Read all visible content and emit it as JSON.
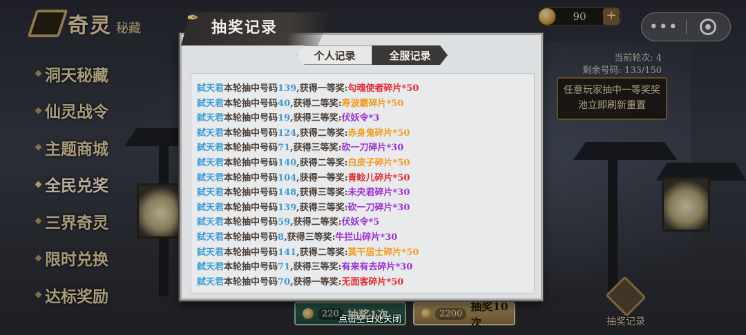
{
  "sidebar": {
    "logo_title": "奇灵",
    "logo_sub": "秘藏",
    "items": [
      {
        "label": "洞天秘藏",
        "active": false
      },
      {
        "label": "仙灵战令",
        "active": false
      },
      {
        "label": "主题商城",
        "active": false
      },
      {
        "label": "全民兑奖",
        "active": true
      },
      {
        "label": "三界奇灵",
        "active": false
      },
      {
        "label": "限时兑换",
        "active": false
      },
      {
        "label": "达标奖励",
        "active": false
      }
    ]
  },
  "topbar": {
    "gold_value": "90",
    "plus_label": "+",
    "more_label": "•••"
  },
  "round_info": {
    "current_round": "当前轮次: 4",
    "remaining_codes": "剩余号码: 133/150"
  },
  "notice": "任意玩家抽中一等奖奖池立即刷新重置",
  "record_button_label": "抽奖记录",
  "bottom": {
    "once_cost": "220",
    "once_label": "抽奖1次",
    "ten_cost": "2200",
    "ten_label": "抽奖10次",
    "close_hint": "点击空白处关闭"
  },
  "dialog": {
    "title": "抽奖记录",
    "tab_personal": "个人记录",
    "tab_all": "全服记录",
    "colors": {
      "first": "#e8282d",
      "second": "#f39a1a",
      "third": "#9b30d9",
      "name": "#3b9bd8"
    },
    "records": [
      {
        "name": "弑天君",
        "mid": "本轮抽中号码",
        "code": "139",
        "prize_label": ",获得一等奖:",
        "prize": "勾魂使者碎片*50",
        "tier": "first"
      },
      {
        "name": "弑天君",
        "mid": "本轮抽中号码",
        "code": "40",
        "prize_label": ",获得二等奖:",
        "prize": "寿波霸碎片*50",
        "tier": "second"
      },
      {
        "name": "弑天君",
        "mid": "本轮抽中号码",
        "code": "19",
        "prize_label": ",获得三等奖:",
        "prize": "伏妖令*3",
        "tier": "third"
      },
      {
        "name": "弑天君",
        "mid": "本轮抽中号码",
        "code": "124",
        "prize_label": ",获得二等奖:",
        "prize": "赤身鬼碎片*50",
        "tier": "second"
      },
      {
        "name": "弑天君",
        "mid": "本轮抽中号码",
        "code": "71",
        "prize_label": ",获得三等奖:",
        "prize": "砍一刀碎片*30",
        "tier": "third"
      },
      {
        "name": "弑天君",
        "mid": "本轮抽中号码",
        "code": "140",
        "prize_label": ",获得二等奖:",
        "prize": "白皮子碎片*50",
        "tier": "second"
      },
      {
        "name": "弑天君",
        "mid": "本轮抽中号码",
        "code": "104",
        "prize_label": ",获得一等奖:",
        "prize": "青睑儿碎片*50",
        "tier": "first"
      },
      {
        "name": "弑天君",
        "mid": "本轮抽中号码",
        "code": "148",
        "prize_label": ",获得三等奖:",
        "prize": "未央君碎片*30",
        "tier": "third"
      },
      {
        "name": "弑天君",
        "mid": "本轮抽中号码",
        "code": "139",
        "prize_label": ",获得三等奖:",
        "prize": "砍一刀碎片*30",
        "tier": "third"
      },
      {
        "name": "弑天君",
        "mid": "本轮抽中号码",
        "code": "59",
        "prize_label": ",获得二等奖:",
        "prize": "伏妖令*5",
        "tier": "third"
      },
      {
        "name": "弑天君",
        "mid": "本轮抽中号码",
        "code": "8",
        "prize_label": ",获得三等奖:",
        "prize": "牛拦山碎片*30",
        "tier": "third"
      },
      {
        "name": "弑天君",
        "mid": "本轮抽中号码",
        "code": "141",
        "prize_label": ",获得二等奖:",
        "prize": "莫干居士碎片*50",
        "tier": "second"
      },
      {
        "name": "弑天君",
        "mid": "本轮抽中号码",
        "code": "71",
        "prize_label": ",获得三等奖:",
        "prize": "有来有去碎片*30",
        "tier": "third"
      },
      {
        "name": "弑天君",
        "mid": "本轮抽中号码",
        "code": "70",
        "prize_label": ",获得一等奖:",
        "prize": "无面客碎片*50",
        "tier": "first"
      }
    ]
  }
}
